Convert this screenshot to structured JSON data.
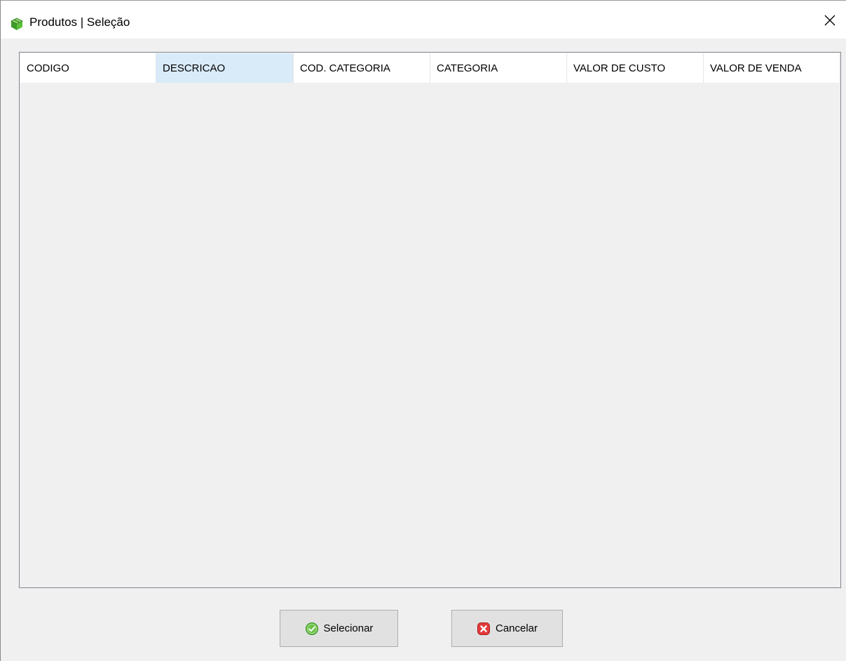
{
  "window": {
    "title": "Produtos | Seleção",
    "app_icon": "green-box-icon",
    "close_icon": "close-icon"
  },
  "grid": {
    "columns": [
      {
        "label": "CODIGO",
        "active": false
      },
      {
        "label": "DESCRICAO",
        "active": true
      },
      {
        "label": "COD. CATEGORIA",
        "active": false
      },
      {
        "label": "CATEGORIA",
        "active": false
      },
      {
        "label": "VALOR DE CUSTO",
        "active": false
      },
      {
        "label": "VALOR DE VENDA",
        "active": false
      }
    ],
    "rows": []
  },
  "buttons": {
    "select": {
      "label": "Selecionar",
      "icon": "green-check-icon"
    },
    "cancel": {
      "label": "Cancelar",
      "icon": "red-x-icon"
    }
  },
  "colors": {
    "active_header": "#d9ebf9",
    "button_bg": "#e1e1e1",
    "window_bg": "#f0f0f0"
  }
}
